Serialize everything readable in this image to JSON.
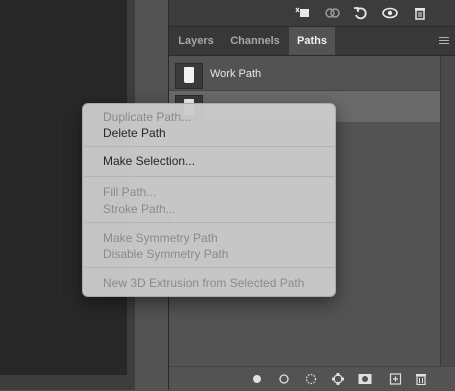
{
  "toolbar_icons": [
    "load-selection-icon",
    "link-icon",
    "undo-icon",
    "eye-icon",
    "trash-icon"
  ],
  "tabs": [
    {
      "label": "Layers",
      "active": false
    },
    {
      "label": "Channels",
      "active": false
    },
    {
      "label": "Paths",
      "active": true
    }
  ],
  "paths": [
    {
      "label": "Work Path",
      "selected": false
    },
    {
      "label": "",
      "selected": true
    }
  ],
  "context_menu": {
    "items": [
      {
        "label": "Duplicate Path...",
        "enabled": false
      },
      {
        "label": "Delete Path",
        "enabled": true
      },
      {
        "label": "Make Selection...",
        "enabled": true
      },
      {
        "label": "Fill Path...",
        "enabled": false
      },
      {
        "label": "Stroke Path...",
        "enabled": false
      },
      {
        "label": "Make Symmetry Path",
        "enabled": false
      },
      {
        "label": "Disable Symmetry Path",
        "enabled": false
      },
      {
        "label": "New 3D Extrusion from Selected Path",
        "enabled": false
      }
    ]
  },
  "bottom_icons": [
    "fill-path-icon",
    "stroke-path-icon",
    "selection-to-path-icon",
    "work-path-icon",
    "add-mask-icon",
    "new-path-icon",
    "delete-path-icon"
  ]
}
